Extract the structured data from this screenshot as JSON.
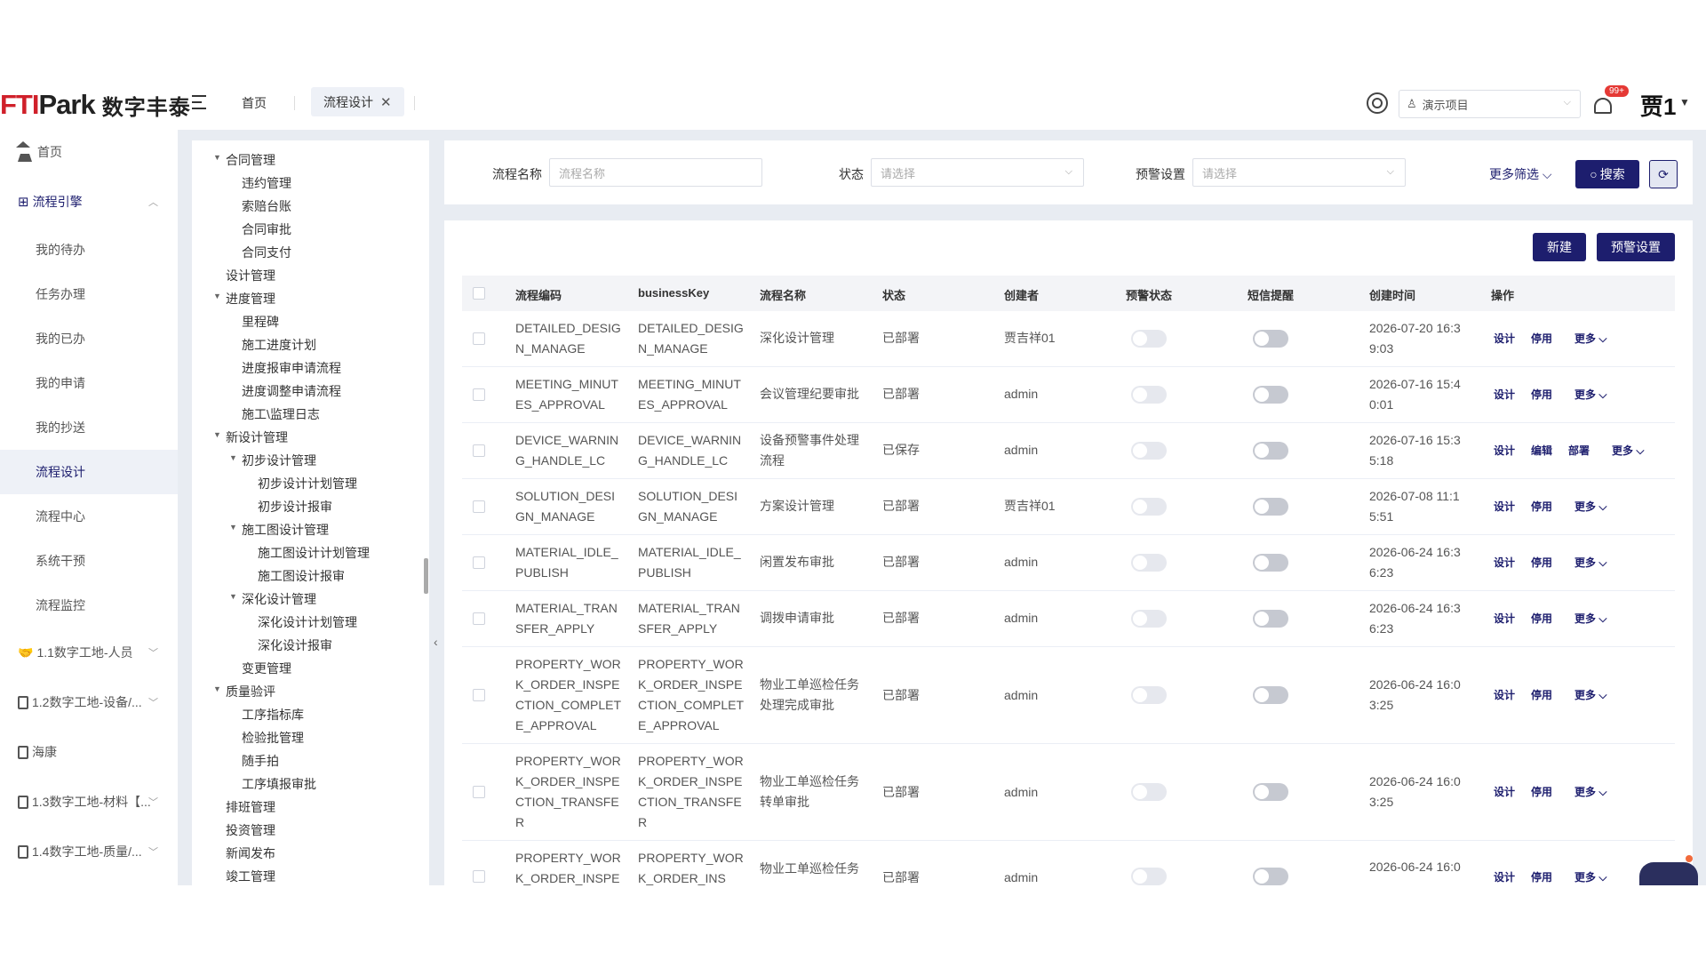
{
  "header": {
    "logo_main": "FTIPark",
    "logo_cn": "数字丰泰",
    "tabs": [
      {
        "label": "首页"
      },
      {
        "label": "流程设计"
      }
    ],
    "project_select": "演示项目",
    "notification_badge": "99+",
    "user_name": "贾1"
  },
  "sidebar": {
    "items": [
      {
        "label": "首页"
      },
      {
        "label": "流程引擎"
      },
      {
        "label": "我的待办"
      },
      {
        "label": "任务办理"
      },
      {
        "label": "我的已办"
      },
      {
        "label": "我的申请"
      },
      {
        "label": "我的抄送"
      },
      {
        "label": "流程设计"
      },
      {
        "label": "流程中心"
      },
      {
        "label": "系统干预"
      },
      {
        "label": "流程监控"
      },
      {
        "label": "1.1数字工地-人员"
      },
      {
        "label": "1.2数字工地-设备/..."
      },
      {
        "label": "海康"
      },
      {
        "label": "1.3数字工地-材料【..."
      },
      {
        "label": "1.4数字工地-质量/..."
      }
    ]
  },
  "tree": [
    {
      "label": "合同管理"
    },
    {
      "label": "违约管理"
    },
    {
      "label": "索赔台账"
    },
    {
      "label": "合同审批"
    },
    {
      "label": "合同支付"
    },
    {
      "label": "设计管理"
    },
    {
      "label": "进度管理"
    },
    {
      "label": "里程碑"
    },
    {
      "label": "施工进度计划"
    },
    {
      "label": "进度报审申请流程"
    },
    {
      "label": "进度调整申请流程"
    },
    {
      "label": "施工\\监理日志"
    },
    {
      "label": "新设计管理"
    },
    {
      "label": "初步设计管理"
    },
    {
      "label": "初步设计计划管理"
    },
    {
      "label": "初步设计报审"
    },
    {
      "label": "施工图设计管理"
    },
    {
      "label": "施工图设计计划管理"
    },
    {
      "label": "施工图设计报审"
    },
    {
      "label": "深化设计管理"
    },
    {
      "label": "深化设计计划管理"
    },
    {
      "label": "深化设计报审"
    },
    {
      "label": "变更管理"
    },
    {
      "label": "质量验评"
    },
    {
      "label": "工序指标库"
    },
    {
      "label": "检验批管理"
    },
    {
      "label": "随手拍"
    },
    {
      "label": "工序填报审批"
    },
    {
      "label": "排班管理"
    },
    {
      "label": "投资管理"
    },
    {
      "label": "新闻发布"
    },
    {
      "label": "竣工管理"
    }
  ],
  "filters": {
    "name_label": "流程名称",
    "name_placeholder": "流程名称",
    "status_label": "状态",
    "status_placeholder": "请选择",
    "warning_label": "预警设置",
    "warning_placeholder": "请选择",
    "more_filter": "更多筛选",
    "search_button": "搜索"
  },
  "toolbar": {
    "new_button": "新建",
    "warning_button": "预警设置"
  },
  "table": {
    "columns": [
      "流程编码",
      "businessKey",
      "流程名称",
      "状态",
      "创建者",
      "预警状态",
      "短信提醒",
      "创建时间",
      "操作"
    ],
    "rows": [
      {
        "code": "DETAILED_DESIGN_MANAGE",
        "key": "DETAILED_DESIGN_MANAGE",
        "name": "深化设计管理",
        "status": "已部署",
        "creator": "贾吉祥01",
        "time": "2026-07-20 16:39:03",
        "ops": [
          "设计",
          "停用",
          "更多"
        ]
      },
      {
        "code": "MEETING_MINUTES_APPROVAL",
        "key": "MEETING_MINUTES_APPROVAL",
        "name": "会议管理纪要审批",
        "status": "已部署",
        "creator": "admin",
        "time": "2026-07-16 15:40:01",
        "ops": [
          "设计",
          "停用",
          "更多"
        ]
      },
      {
        "code": "DEVICE_WARNING_HANDLE_LC",
        "key": "DEVICE_WARNING_HANDLE_LC",
        "name": "设备预警事件处理流程",
        "status": "已保存",
        "creator": "admin",
        "time": "2026-07-16 15:35:18",
        "ops": [
          "设计",
          "编辑",
          "部署",
          "更多"
        ]
      },
      {
        "code": "SOLUTION_DESIGN_MANAGE",
        "key": "SOLUTION_DESIGN_MANAGE",
        "name": "方案设计管理",
        "status": "已部署",
        "creator": "贾吉祥01",
        "time": "2026-07-08 11:15:51",
        "ops": [
          "设计",
          "停用",
          "更多"
        ]
      },
      {
        "code": "MATERIAL_IDLE_PUBLISH",
        "key": "MATERIAL_IDLE_PUBLISH",
        "name": "闲置发布审批",
        "status": "已部署",
        "creator": "admin",
        "time": "2026-06-24 16:36:23",
        "ops": [
          "设计",
          "停用",
          "更多"
        ]
      },
      {
        "code": "MATERIAL_TRANSFER_APPLY",
        "key": "MATERIAL_TRANSFER_APPLY",
        "name": "调拨申请审批",
        "status": "已部署",
        "creator": "admin",
        "time": "2026-06-24 16:36:23",
        "ops": [
          "设计",
          "停用",
          "更多"
        ]
      },
      {
        "code": "PROPERTY_WORK_ORDER_INSPECTION_COMPLETE_APPROVAL",
        "key": "PROPERTY_WORK_ORDER_INSPECTION_COMPLETE_APPROVAL",
        "name": "物业工单巡检任务处理完成审批",
        "status": "已部署",
        "creator": "admin",
        "time": "2026-06-24 16:03:25",
        "ops": [
          "设计",
          "停用",
          "更多"
        ]
      },
      {
        "code": "PROPERTY_WORK_ORDER_INSPECTION_TRANSFER",
        "key": "PROPERTY_WORK_ORDER_INSPECTION_TRANSFER",
        "name": "物业工单巡检任务转单审批",
        "status": "已部署",
        "creator": "admin",
        "time": "2026-06-24 16:03:25",
        "ops": [
          "设计",
          "停用",
          "更多"
        ]
      },
      {
        "code": "PROPERTY_WORK_ORDER_INSPE",
        "key": "PROPERTY_WORK_ORDER_INS",
        "name": "物业工单巡检任务",
        "status": "已部署",
        "creator": "admin",
        "time": "2026-06-24 16:0",
        "ops": [
          "设计",
          "停用",
          "更多"
        ]
      }
    ]
  }
}
